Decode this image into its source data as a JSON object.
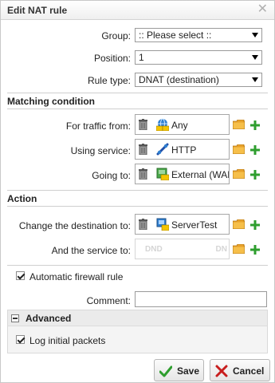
{
  "dialog": {
    "title": "Edit NAT rule",
    "close_glyph": "✕"
  },
  "general": {
    "group": {
      "label": "Group:",
      "value": ":: Please select ::"
    },
    "position": {
      "label": "Position:",
      "value": "1"
    },
    "rule_type": {
      "label": "Rule type:",
      "value": "DNAT (destination)"
    }
  },
  "matching": {
    "heading": "Matching condition",
    "traffic_from": {
      "label": "For traffic from:",
      "value": "Any",
      "icon": "network-any-icon"
    },
    "using_service": {
      "label": "Using service:",
      "value": "HTTP",
      "icon": "service-icon"
    },
    "going_to": {
      "label": "Going to:",
      "value": "External (WAN)",
      "icon": "external-interface-icon"
    }
  },
  "action": {
    "heading": "Action",
    "change_destination": {
      "label": "Change the destination to:",
      "value": "ServerTest",
      "icon": "server-host-icon"
    },
    "service_to": {
      "label": "And the service to:",
      "placeholder_left": "DND",
      "placeholder_right": "DN"
    }
  },
  "auto_firewall": {
    "label": "Automatic firewall rule",
    "checked": true
  },
  "comment": {
    "label": "Comment:",
    "value": ""
  },
  "advanced": {
    "heading": "Advanced",
    "log_initial": {
      "label": "Log initial packets",
      "checked": true
    }
  },
  "buttons": {
    "save": "Save",
    "cancel": "Cancel"
  },
  "colors": {
    "accent_green": "#2e9e2e",
    "cancel_red": "#c81e1e",
    "folder": "#e8a22b"
  }
}
